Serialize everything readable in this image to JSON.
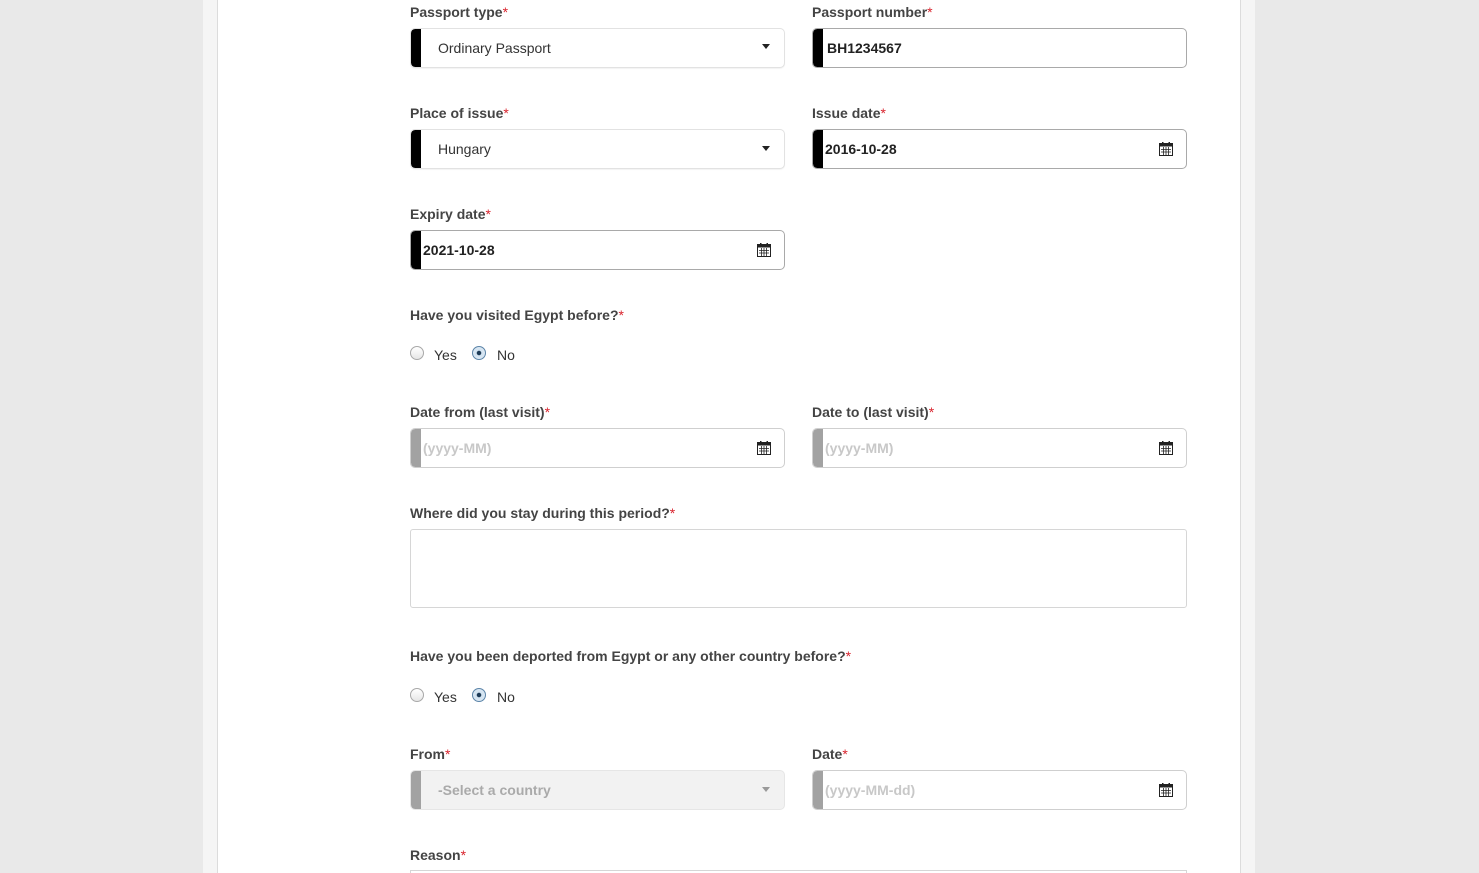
{
  "passport_type": {
    "label": "Passport type",
    "required": "*",
    "value": "Ordinary Passport",
    "icon": "chevron-down-icon"
  },
  "passport_number": {
    "label": "Passport number",
    "required": "*",
    "value": "BH1234567"
  },
  "place_of_issue": {
    "label": "Place of issue",
    "required": "*",
    "value": "Hungary",
    "icon": "chevron-down-icon"
  },
  "issue_date": {
    "label": "Issue date",
    "required": "*",
    "value": "2016-10-28",
    "icon": "calendar-icon"
  },
  "expiry_date": {
    "label": "Expiry date",
    "required": "*",
    "value": "2021-10-28",
    "icon": "calendar-icon"
  },
  "visited_before": {
    "question": "Have you visited Egypt before?",
    "required": "*",
    "options": [
      "Yes",
      "No"
    ],
    "selected": "No"
  },
  "date_from_last": {
    "label": "Date from (last visit)",
    "required": "*",
    "placeholder": "(yyyy-MM)",
    "icon": "calendar-icon"
  },
  "date_to_last": {
    "label": "Date to (last visit)",
    "required": "*",
    "placeholder": "(yyyy-MM)",
    "icon": "calendar-icon"
  },
  "stay_location": {
    "label": "Where did you stay during this period?",
    "required": "*",
    "value": ""
  },
  "deported_before": {
    "question": "Have you been deported from Egypt or any other country before?",
    "required": "*",
    "options": [
      "Yes",
      "No"
    ],
    "selected": "No"
  },
  "deport_from": {
    "label": "From",
    "required": "*",
    "placeholder": "-Select a country",
    "icon": "chevron-down-icon"
  },
  "deport_date": {
    "label": "Date",
    "required": "*",
    "placeholder": "(yyyy-MM-dd)",
    "icon": "calendar-icon"
  },
  "reason": {
    "label": "Reason",
    "required": "*"
  },
  "colors": {
    "required": "#d9232d",
    "field_bar": "#000000",
    "disabled_bar": "#a2a2a2",
    "background": "#e9e9e9"
  }
}
